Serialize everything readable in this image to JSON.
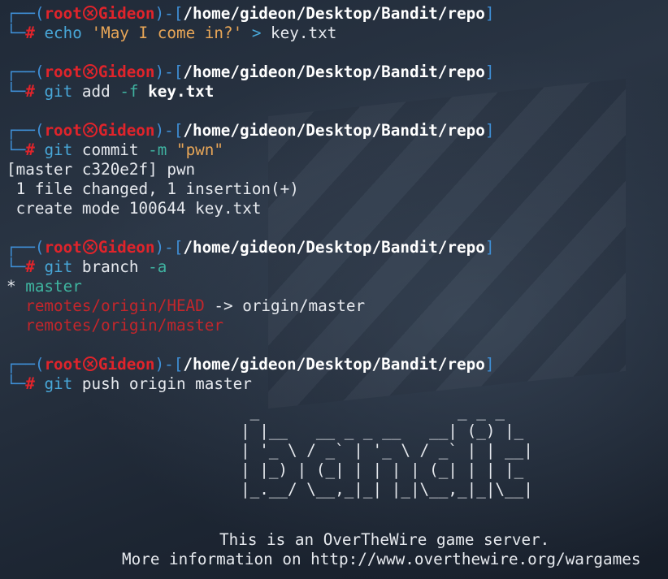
{
  "prompt": {
    "top": "┌──(",
    "user": "root",
    "icon": "skull-icon",
    "host": "Gideon",
    "close_paren": ")-[",
    "path": "/home/gideon/Desktop/Bandit/repo",
    "close_bracket": "]",
    "bottom": "└─",
    "hash": "# "
  },
  "commands": [
    {
      "cmd": "echo",
      "args": [
        {
          "t": " ",
          "c": "plain"
        },
        {
          "t": "'May I come in?'",
          "c": "str"
        },
        {
          "t": " ",
          "c": "plain"
        },
        {
          "t": ">",
          "c": "cmd"
        },
        {
          "t": " key.txt",
          "c": "plain"
        }
      ]
    },
    {
      "cmd": "git",
      "args": [
        {
          "t": " add ",
          "c": "plain"
        },
        {
          "t": "-f",
          "c": "opt"
        },
        {
          "t": " ",
          "c": "plain"
        },
        {
          "t": "key.txt",
          "c": "bold"
        }
      ]
    },
    {
      "cmd": "git",
      "args": [
        {
          "t": " commit ",
          "c": "plain"
        },
        {
          "t": "-m",
          "c": "opt"
        },
        {
          "t": " ",
          "c": "plain"
        },
        {
          "t": "\"pwn\"",
          "c": "str"
        }
      ]
    },
    {
      "cmd": "git",
      "args": [
        {
          "t": " branch ",
          "c": "plain"
        },
        {
          "t": "-a",
          "c": "opt"
        }
      ]
    },
    {
      "cmd": "git",
      "args": [
        {
          "t": " push origin master",
          "c": "plain"
        }
      ]
    }
  ],
  "outputs": {
    "commit": [
      "[master c320e2f] pwn",
      " 1 file changed, 1 insertion(+)",
      " create mode 100644 key.txt"
    ],
    "branch_current_marker": "* ",
    "branch_current": "master",
    "branch_remote_head": "  remotes/origin/HEAD",
    "branch_remote_head_arrow": " -> origin/master",
    "branch_remote_master": "  remotes/origin/master"
  },
  "banner": [
    " _                     _ _ _   ",
    "| |__   __ _ _ __   __| (_) |_ ",
    "| '_ \\ / _` | '_ \\ / _` | | __|",
    "| |_) | (_| | | | | (_| | | |_ ",
    "|_.__/ \\__,_|_| |_|\\__,_|_|\\__|"
  ],
  "footer": {
    "line1": "This is an OverTheWire game server.",
    "line2": "More information on http://www.overthewire.org/wargames"
  },
  "colors": {
    "prompt_frame": "#3f8fd6",
    "user_host": "#e0242b",
    "command": "#48a7d8",
    "string": "#e8a657",
    "option": "#3fb2a0",
    "remote_branch": "#c4262b",
    "background": "#1c2430"
  }
}
